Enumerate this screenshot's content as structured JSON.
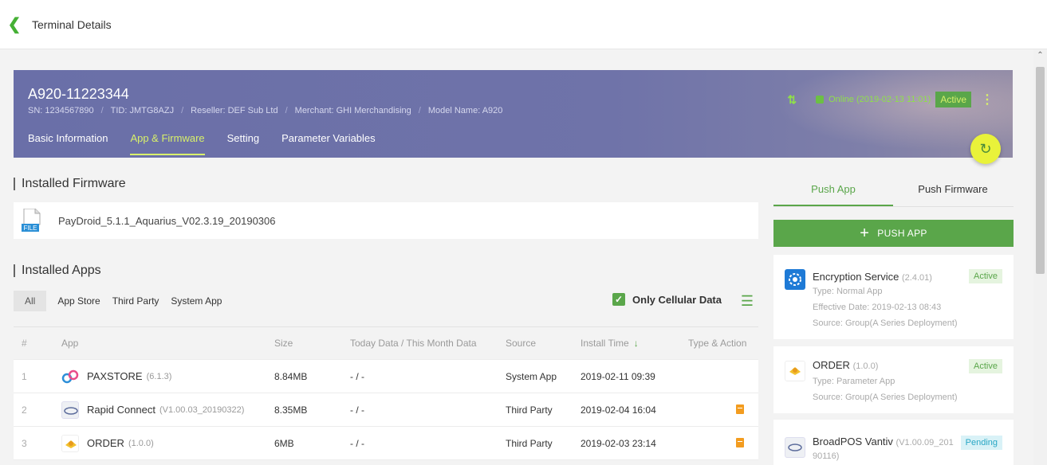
{
  "topbar": {
    "title": "Terminal Details"
  },
  "terminal": {
    "name": "A920-11223344",
    "sn": "SN: 1234567890",
    "tid": "TID: JMTG8AZJ",
    "reseller": "Reseller: DEF Sub Ltd",
    "merchant": "Merchant: GHI Merchandising",
    "model": "Model Name: A920",
    "online": "Online (2019-02-13 11:01)",
    "status": "Active",
    "tabs": [
      "Basic Information",
      "App & Firmware",
      "Setting",
      "Parameter Variables"
    ],
    "active_tab": "App & Firmware"
  },
  "firmware": {
    "section_title": "Installed Firmware",
    "file_label": "FILE",
    "name": "PayDroid_5.1.1_Aquarius_V02.3.19_20190306"
  },
  "apps": {
    "section_title": "Installed Apps",
    "filters": [
      "All",
      "App Store",
      "Third Party",
      "System App"
    ],
    "cellular_label": "Only Cellular Data",
    "columns": [
      "#",
      "App",
      "Size",
      "Today Data / This Month Data",
      "Source",
      "Install Time",
      "Type & Action"
    ],
    "rows": [
      {
        "num": "1",
        "name": "PAXSTORE",
        "version": "(6.1.3)",
        "size": "8.84MB",
        "data": "- / -",
        "source": "System App",
        "time": "2019-02-11 09:39"
      },
      {
        "num": "2",
        "name": "Rapid Connect",
        "version": "(V1.00.03_20190322)",
        "size": "8.35MB",
        "data": "- / -",
        "source": "Third Party",
        "time": "2019-02-04 16:04"
      },
      {
        "num": "3",
        "name": "ORDER",
        "version": "(1.0.0)",
        "size": "6MB",
        "data": "- / -",
        "source": "Third Party",
        "time": "2019-02-03 23:14"
      }
    ]
  },
  "push": {
    "tabs": [
      "Push App",
      "Push Firmware"
    ],
    "button": "PUSH APP",
    "cards": [
      {
        "name": "Encryption Service",
        "version": "(2.4.01)",
        "badge": "Active",
        "line1": "Type: Normal App",
        "line2": "Effective Date: 2019-02-13 08:43",
        "line3": "Source: Group(A Series Deployment)"
      },
      {
        "name": "ORDER",
        "version": "(1.0.0)",
        "badge": "Active",
        "line1": "Type: Parameter App",
        "line2": "Source: Group(A Series Deployment)"
      },
      {
        "name": "BroadPOS Vantiv",
        "version": "(V1.00.09_201",
        "version2": "90116)",
        "badge": "Pending"
      }
    ]
  },
  "colors": {
    "accent": "#5aa64a",
    "banner": "#6a6fa8",
    "highlight": "#d8f06a",
    "fab": "#e9f23a"
  }
}
